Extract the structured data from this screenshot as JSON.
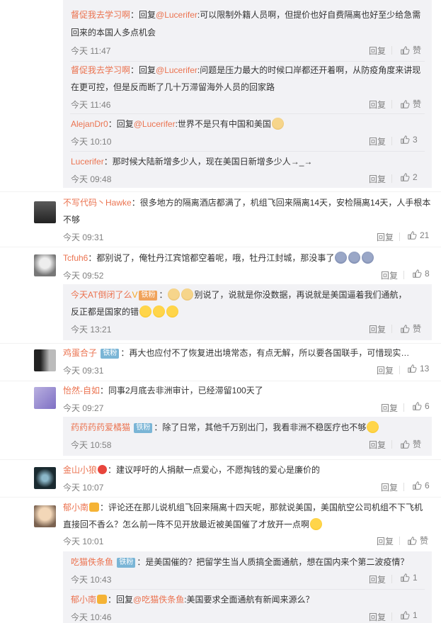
{
  "ui": {
    "reply": "回复",
    "like": "赞"
  },
  "fan_badge": "铁粉",
  "comments": {
    "c0": {
      "subs": {
        "s1": {
          "name": "督促我去学习啊",
          "pre": "：回复",
          "at": "@Lucerifer",
          "line1": ":可以限制外籍人员啊，但提价也好自费隔离也好至少给急需",
          "line2": "回来的本国人多点机会",
          "time": "今天 11:47",
          "likes": "赞"
        },
        "s2": {
          "name": "督促我去学习啊",
          "pre": "：回复",
          "at": "@Lucerifer",
          "line1": ":问题是压力最大的时候口岸都还开着啊，从防疫角度来讲现",
          "line2": "在更可控，但是反而断了几十万滞留海外人员的回家路",
          "time": "今天 11:46",
          "likes": "赞"
        },
        "s3": {
          "name": "AlejanDr0",
          "pre": "：回复",
          "at": "@Lucerifer",
          "line1": ":世界不是只有中国和美国",
          "time": "今天 10:10",
          "likes": "3"
        },
        "s4": {
          "name": "Lucerifer",
          "line1": "：那时候大陆新增多少人，现在美国日新增多少人→_→",
          "time": "今天 09:48",
          "likes": "2"
        }
      }
    },
    "c1": {
      "name": "不写代码丶Hawke",
      "line1": "：很多地方的隔离酒店都满了，机组飞回来隔离14天，安检隔离14天，人手根本",
      "line2": "不够",
      "time": "今天 09:31",
      "likes": "21"
    },
    "c2": {
      "name": "Tcfuh6",
      "line1": "：都别说了，俺牡丹江宾馆都空着呢，哦，牡丹江封城，那没事了",
      "time": "今天 09:52",
      "likes": "8",
      "sub": {
        "name": "今天AT倒闭了么",
        "line1": "别说了，说就是你没数据，再说就是美国逼着我们通航，",
        "line2": "反正都是国家的错",
        "time": "今天 13:21",
        "likes": "赞"
      }
    },
    "c3": {
      "name": "鸡蛋合子",
      "line1": "：再大也应付不了恢复进出境常态，有点无解，所以要各国联手，可惜现实…",
      "time": "今天 09:31",
      "likes": "13"
    },
    "c4": {
      "name": "怡然-自如",
      "line1": "：同事2月底去非洲审计，已经滞留100天了",
      "time": "今天 09:27",
      "likes": "6",
      "sub": {
        "name": "药药药药爱橘猫",
        "line1": "：除了日常，其他千万别出门，我看非洲不稳医疗也不够",
        "time": "今天 10:58",
        "likes": "赞"
      }
    },
    "c5": {
      "name": "金山小狼",
      "line1": "：建议呼吁的人捐献一点爱心，不愿掏钱的爱心是廉价的",
      "time": "今天 10:07",
      "likes": "6"
    },
    "c6": {
      "name": "郁小南",
      "line1": "：评论还在那儿说机组飞回来隔离十四天呢，那就说美国，美国航空公司机组不下飞机",
      "line2": "直接回不香么？怎么前一阵不见开放最近被美国催了才放开一点啊",
      "time": "今天 10:01",
      "likes": "赞",
      "subs": {
        "s1": {
          "name": "吃猫佚条鱼",
          "line1": "：是美国催的？把留学生当人质搞全面通航，想在国内来个第二波疫情？",
          "time": "今天 10:43",
          "likes": "1"
        },
        "s2": {
          "name": "郁小南",
          "pre": "：回复",
          "at": "@吃猫佚条鱼",
          "line1": ":美国要求全面通航有新闻来源么？",
          "time": "今天 10:46",
          "likes": "1"
        }
      }
    }
  }
}
